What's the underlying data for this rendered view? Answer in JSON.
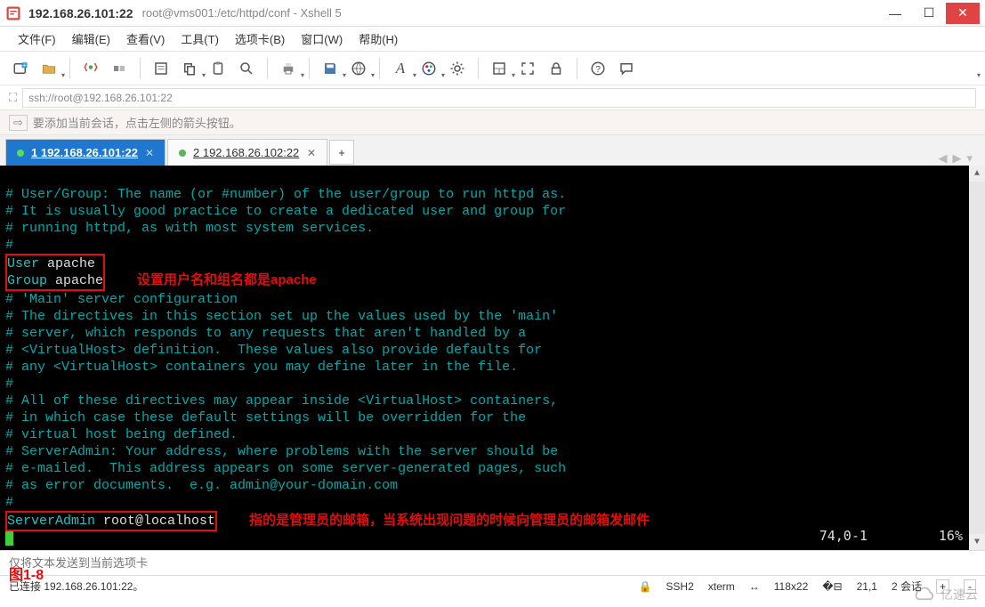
{
  "title": {
    "ip": "192.168.26.101:22",
    "path": "root@vms001:/etc/httpd/conf - Xshell 5"
  },
  "menu": {
    "items": [
      "文件(F)",
      "编辑(E)",
      "查看(V)",
      "工具(T)",
      "选项卡(B)",
      "窗口(W)",
      "帮助(H)"
    ]
  },
  "hint": {
    "text": "要添加当前会话，点击左侧的箭头按钮。"
  },
  "address": {
    "url": "ssh://root@192.168.26.101:22"
  },
  "tabs": {
    "items": [
      {
        "label": "1 192.168.26.101:22",
        "active": true
      },
      {
        "label": "2 192.168.26.102:22",
        "active": false
      }
    ]
  },
  "terminal": {
    "comment_lines": [
      "# User/Group: The name (or #number) of the user/group to run httpd as.",
      "# It is usually good practice to create a dedicated user and group for",
      "# running httpd, as with most system services.",
      "#"
    ],
    "user_line": {
      "key": "User",
      "value": " apache"
    },
    "group_line": {
      "key": "Group",
      "value": " apache"
    },
    "annot1": "设置用户名和组名都是apache",
    "mid_lines": [
      "# 'Main' server configuration",
      "# The directives in this section set up the values used by the 'main'",
      "# server, which responds to any requests that aren't handled by a",
      "# <VirtualHost> definition.  These values also provide defaults for",
      "# any <VirtualHost> containers you may define later in the file.",
      "#",
      "# All of these directives may appear inside <VirtualHost> containers,",
      "# in which case these default settings will be overridden for the",
      "# virtual host being defined.",
      "# ServerAdmin: Your address, where problems with the server should be",
      "# e-mailed.  This address appears on some server-generated pages, such",
      "# as error documents.  e.g. admin@your-domain.com",
      "#"
    ],
    "serveradmin_line": {
      "key": "ServerAdmin",
      "value": " root@localhost"
    },
    "annot2": "指的是管理员的邮箱，当系统出现问题的时候向管理员的邮箱发邮件",
    "status_pos": "74,0-1",
    "status_pct": "16%"
  },
  "footer": {
    "placeholder": "仅将文本发送到当前选项卡",
    "figure_label": "图1-8"
  },
  "status": {
    "conn": "已连接 192.168.26.101:22。",
    "proto": "SSH2",
    "term": "xterm",
    "size": "118x22",
    "cursor": "21,1",
    "sessions": "2 会话"
  },
  "watermark": {
    "text": "亿速云"
  }
}
